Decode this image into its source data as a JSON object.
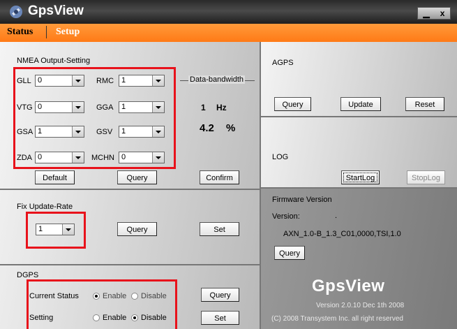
{
  "window": {
    "title": "GpsView",
    "minimize_glyph": "▁",
    "close_glyph": "x"
  },
  "tabs": [
    {
      "label": "Status"
    },
    {
      "label": "Setup"
    }
  ],
  "nmea": {
    "heading": "NMEA Output-Setting",
    "fields": [
      {
        "label": "GLL",
        "value": "0"
      },
      {
        "label": "RMC",
        "value": "1"
      },
      {
        "label": "VTG",
        "value": "0"
      },
      {
        "label": "GGA",
        "value": "1"
      },
      {
        "label": "GSA",
        "value": "1"
      },
      {
        "label": "GSV",
        "value": "1"
      },
      {
        "label": "ZDA",
        "value": "0"
      },
      {
        "label": "MCHN",
        "value": "0"
      }
    ],
    "bandwidth": {
      "heading": "Data-bandwidth",
      "hz_value": "1",
      "hz_unit": "Hz",
      "pct_value": "4.2",
      "pct_unit": "%"
    },
    "buttons": {
      "default": "Default",
      "query": "Query",
      "confirm": "Confirm"
    }
  },
  "fix_rate": {
    "heading": "Fix Update-Rate",
    "value": "1",
    "query": "Query",
    "set": "Set"
  },
  "dgps": {
    "heading": "DGPS",
    "current_label": "Current Status",
    "setting_label": "Setting",
    "enable": "Enable",
    "disable": "Disable",
    "current_selected": "Enable",
    "setting_selected": "Disable",
    "query": "Query",
    "set": "Set"
  },
  "agps": {
    "heading": "AGPS",
    "query": "Query",
    "update": "Update",
    "reset": "Reset"
  },
  "log": {
    "heading": "LOG",
    "start": "StartLog",
    "stop": "StopLog"
  },
  "firmware": {
    "heading": "Firmware Version",
    "version_label": "Version:",
    "dot": ".",
    "version_value": "AXN_1.0-B_1.3_C01,0000,TSI,1.0",
    "query": "Query"
  },
  "branding": {
    "name": "GpsView",
    "version_line": "Version 2.0.10  Dec 1th 2008",
    "copyright": "(C) 2008 Transystem Inc. all right reserved"
  },
  "colors": {
    "highlight_red": "#e8121b",
    "tab_orange": "#ff8a24",
    "title_bar": "#333333"
  }
}
